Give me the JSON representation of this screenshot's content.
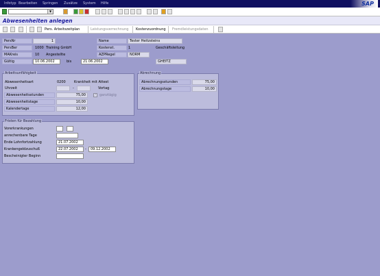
{
  "menubar": {
    "items": [
      "Infotyp",
      "Bearbeiten",
      "Springen",
      "Zusätze",
      "System",
      "Hilfe"
    ],
    "logo": "SAP"
  },
  "toolbar": {
    "command_value": "",
    "icons": [
      "enter-icon",
      "save-icon",
      "back-icon",
      "exit-icon",
      "cancel-icon",
      "print-icon",
      "find-icon",
      "find-next-icon",
      "first-page-icon",
      "prev-page-icon",
      "next-page-icon",
      "last-page-icon",
      "new-session-icon",
      "shortcut-icon",
      "help-icon"
    ]
  },
  "title": "Abwesenheiten anlegen",
  "app_toolbar": {
    "buttons": [
      {
        "label": "Pers. Arbeitszeitplan",
        "enabled": true
      },
      {
        "label": "Leistungsverrechnung",
        "enabled": false
      },
      {
        "label": "Kostenzuordnung",
        "enabled": true
      },
      {
        "label": "Fremdleistungsdaten",
        "enabled": false
      }
    ]
  },
  "header": {
    "persnr": {
      "label": "PersNr",
      "value": "1"
    },
    "name": {
      "label": "Name",
      "value": "Tester Heitzsteins"
    },
    "persber": {
      "label": "PersBer",
      "code": "1000",
      "text": "Training GmbH"
    },
    "kostenst": {
      "label": "Kostenst.",
      "code": "1",
      "text": "Geschäftsleitung"
    },
    "makreis": {
      "label": "MAKreis",
      "code": "10",
      "text": "Angestellte"
    },
    "azpregel": {
      "label": "AZPRegel",
      "value": "NORM"
    },
    "gueltig": {
      "label": "Gültig",
      "from": "10.06.2002",
      "bis_label": "bis",
      "to": "21.06.2002"
    },
    "user": "GHEITZ"
  },
  "arbeitsunfaehigkeit": {
    "title": "Arbeitsunfähigkeit",
    "abwesenheitsart": {
      "label": "Abwesenheitsart",
      "code": "0200",
      "text": "Krankheit mit Attest"
    },
    "uhrzeit": {
      "label": "Uhrzeit",
      "from": "",
      "to": "",
      "vortag_label": "Vortag"
    },
    "ganztaegig_label": "ganztägig",
    "abwesenheitsstunden": {
      "label": "Abwesenheitsstunden",
      "value": "75,00"
    },
    "abwesenheitstage": {
      "label": "Abwesenheitstage",
      "value": "10,00"
    },
    "kalendertage": {
      "label": "Kalendertage",
      "value": "12,00"
    }
  },
  "abrechnung": {
    "title": "Abrechnung",
    "stunden": {
      "label": "Abrechnungsstunden",
      "value": "75,00"
    },
    "tage": {
      "label": "Abrechnungstage",
      "value": "10,00"
    }
  },
  "fristen": {
    "title": "Fristen für Bezahlung",
    "vorerkrankungen": {
      "label": "Vorerkrankungen",
      "v1": "",
      "v2": ""
    },
    "anrechenbare": {
      "label": "anrechenbare Tage",
      "value": ""
    },
    "ende_lfz": {
      "label": "Ende Lohnfortzahlung",
      "value": "21.07.2002"
    },
    "krankengeld": {
      "label": "Krankengeldzuschuß",
      "from": "22.07.2002",
      "to": "09.12.2002"
    },
    "bescheinigter": {
      "label": "Bescheinigter Beginn",
      "value": ""
    }
  }
}
